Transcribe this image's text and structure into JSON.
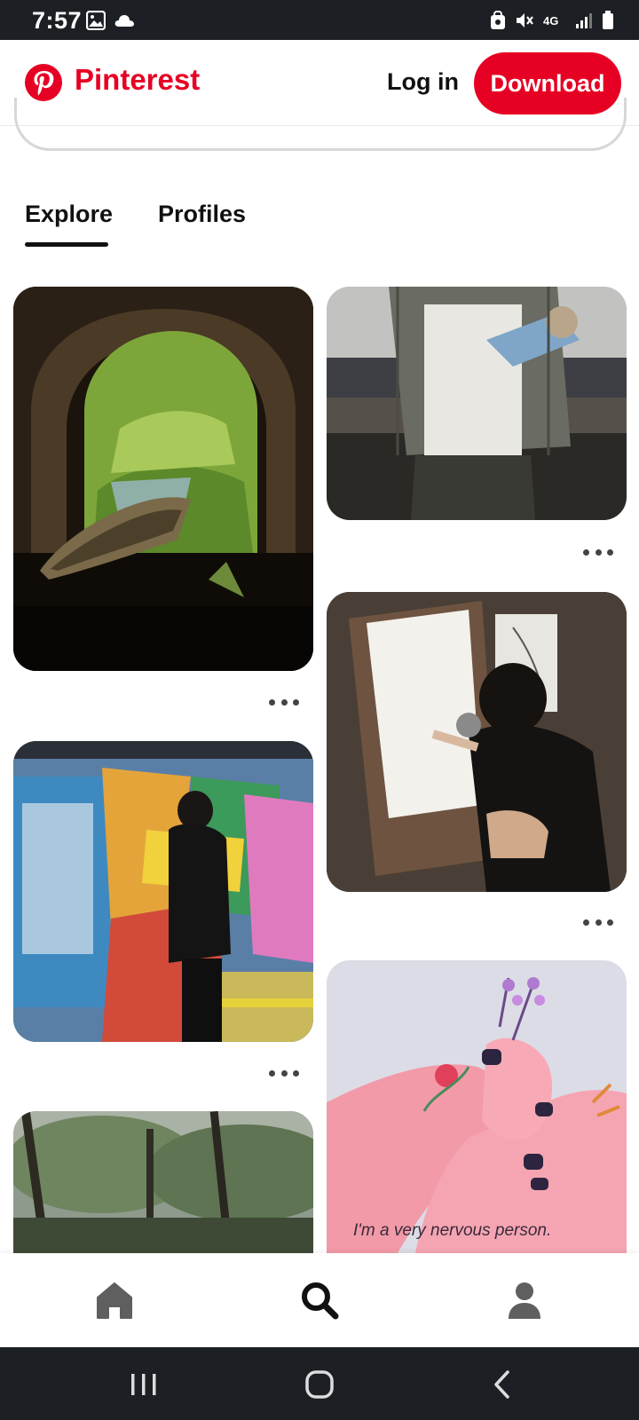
{
  "status_bar": {
    "time": "7:57",
    "network": "4G"
  },
  "header": {
    "brand": "Pinterest",
    "login_label": "Log in",
    "download_label": "Download"
  },
  "tabs": [
    {
      "label": "Explore",
      "active": true
    },
    {
      "label": "Profiles",
      "active": false
    }
  ],
  "pins": [
    {
      "name": "pin-tunnel-boat",
      "icon": "image"
    },
    {
      "name": "pin-plaid-shirt-flowers",
      "icon": "image"
    },
    {
      "name": "pin-graffiti-train",
      "icon": "image"
    },
    {
      "name": "pin-drawing-easel",
      "icon": "image"
    },
    {
      "name": "pin-misty-forest",
      "icon": "image"
    },
    {
      "name": "pin-nervous-hands",
      "icon": "image",
      "caption": "I'm a very nervous person."
    }
  ],
  "bottom_nav": [
    "home-icon",
    "search-icon",
    "profile-icon"
  ],
  "colors": {
    "brand_red": "#e60023",
    "status_bar": "#1c1f23"
  }
}
